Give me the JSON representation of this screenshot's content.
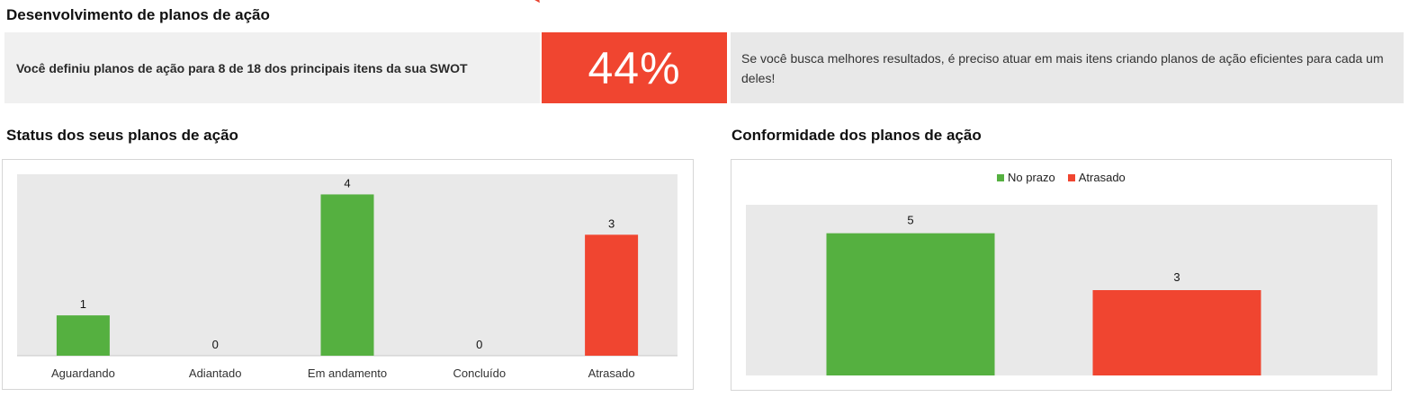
{
  "header": {
    "title": "Desenvolvimento de planos de ação"
  },
  "summary": {
    "left_text": "Você definiu planos de ação para 8 de 18 dos principais itens da sua SWOT",
    "percent": "44%",
    "right_text": "Se você busca melhores resultados, é preciso atuar em mais itens criando planos de ação eficientes para cada um deles!"
  },
  "colors": {
    "green": "#55b040",
    "red": "#f04530",
    "plot_bg": "#e9e9e9"
  },
  "chart_data": [
    {
      "type": "bar",
      "title": "Status dos seus planos de ação",
      "categories": [
        "Aguardando",
        "Adiantado",
        "Em andamento",
        "Concluído",
        "Atrasado"
      ],
      "values": [
        1,
        0,
        4,
        0,
        3
      ],
      "labels": [
        "1",
        "0",
        "4",
        "0",
        "3"
      ],
      "bar_colors": [
        "#55b040",
        "#55b040",
        "#55b040",
        "#55b040",
        "#f04530"
      ],
      "ylim": [
        0,
        4.5
      ],
      "grid": false,
      "legend": "none"
    },
    {
      "type": "bar",
      "title": "Conformidade dos planos de ação",
      "categories": [
        "No prazo",
        "Atrasado"
      ],
      "values": [
        5,
        3
      ],
      "labels": [
        "5",
        "3"
      ],
      "bar_colors": [
        "#55b040",
        "#f04530"
      ],
      "ylim": [
        0,
        6
      ],
      "grid": false,
      "legend": "top-center"
    }
  ]
}
